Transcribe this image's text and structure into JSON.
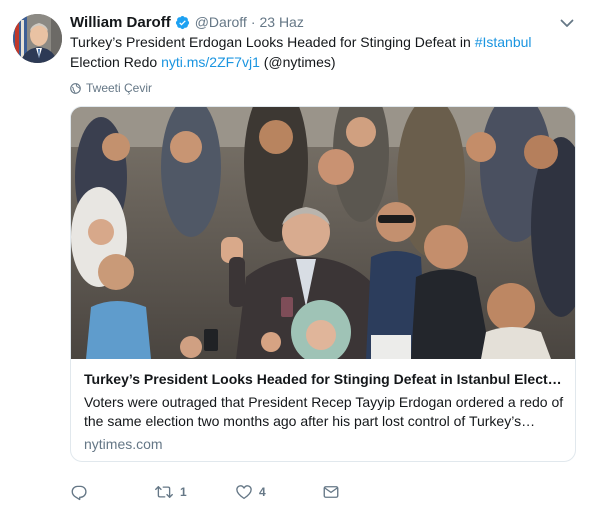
{
  "tweet": {
    "author_name": "William Daroff",
    "handle": "@Daroff",
    "separator": "·",
    "date": "23 Haz",
    "text_plain": "Turkey’s President Erdogan Looks Headed for Stinging Defeat in ",
    "hashtag": "#Istanbul",
    "text_mid": " Election Redo ",
    "link": "nyti.ms/2ZF7vj1",
    "text_end": " (@nytimes)",
    "translate_label": "Tweeti Çevir"
  },
  "card": {
    "title": "Turkey’s President Looks Headed for Stinging Defeat in Istanbul Election Redo",
    "description": "Voters were outraged that President Recep Tayyip Erdogan ordered a redo of the same election two months ago after his part lost control of Turkey’s largest city.",
    "domain": "nytimes.com",
    "image_icon": "news-photo"
  },
  "actions": {
    "reply_count": "",
    "retweet_count": "1",
    "like_count": "4",
    "dm_count": ""
  },
  "icons": {
    "verified": "verified-badge-icon",
    "chevron": "chevron-down-icon",
    "globe": "globe-icon",
    "reply": "reply-icon",
    "retweet": "retweet-icon",
    "like": "heart-icon",
    "message": "envelope-icon"
  },
  "colors": {
    "link": "#1b95e0",
    "verified": "#1da1f2",
    "secondary_text": "#657786",
    "border": "#e1e8ed"
  }
}
